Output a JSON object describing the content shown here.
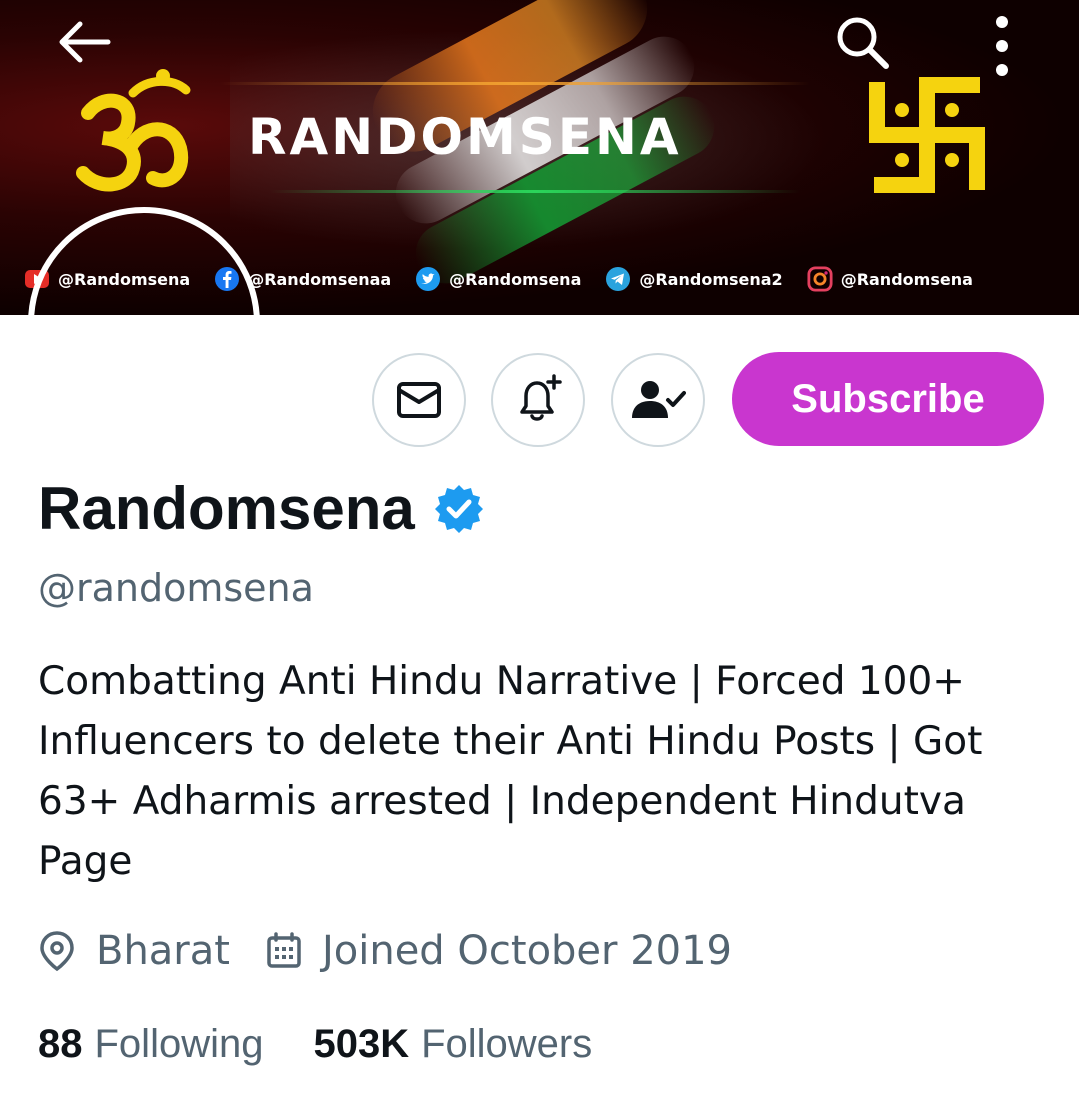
{
  "banner": {
    "brand_text": "RANDOMSENA",
    "socials": [
      {
        "icon": "youtube-icon",
        "handle": "@Randomsena",
        "color": "#e52d27"
      },
      {
        "icon": "facebook-icon",
        "handle": "@Randomsenaa",
        "color": "#1877f2"
      },
      {
        "icon": "twitter-icon",
        "handle": "@Randomsena",
        "color": "#1d9bf0"
      },
      {
        "icon": "telegram-icon",
        "handle": "@Randomsena2",
        "color": "#2aa3de"
      },
      {
        "icon": "instagram-icon",
        "handle": "@Randomsena",
        "color": "#d62976"
      }
    ]
  },
  "top_bar": {
    "back_icon": "arrow-left-icon",
    "search_icon": "search-icon",
    "more_icon": "more-vertical-icon"
  },
  "actions": {
    "message_icon": "mail-icon",
    "notify_icon": "bell-plus-icon",
    "follow_icon": "following-check-icon",
    "subscribe_label": "Subscribe",
    "subscribe_color": "#c936cf"
  },
  "profile": {
    "name": "Randomsena",
    "verified_color": "#1d9bf0",
    "handle": "@randomsena",
    "bio": "Combatting Anti Hindu Narrative | Forced 100+ Influencers to delete their Anti Hindu Posts | Got 63+ Adharmis arrested | Independent Hindutva Page",
    "location": "Bharat",
    "joined": "Joined October 2019"
  },
  "stats": {
    "following_count": "88",
    "following_label": "Following",
    "followers_count": "503K",
    "followers_label": "Followers"
  }
}
